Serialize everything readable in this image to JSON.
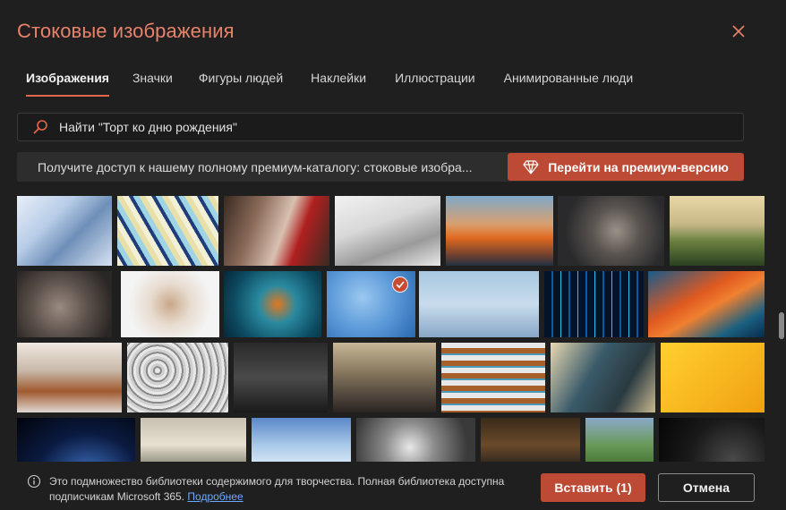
{
  "dialog": {
    "title": "Стоковые изображения",
    "accent_color": "#e0674a",
    "button_color": "#bc4a35"
  },
  "tabs": [
    {
      "label": "Изображения",
      "active": true
    },
    {
      "label": "Значки",
      "active": false
    },
    {
      "label": "Фигуры людей",
      "active": false
    },
    {
      "label": "Наклейки",
      "active": false
    },
    {
      "label": "Иллюстрации",
      "active": false
    },
    {
      "label": "Анимированные люди",
      "active": false
    }
  ],
  "search": {
    "value": "Найти \"Торт ко дню рождения\"",
    "icon": "search-icon"
  },
  "banner": {
    "text": "Получите доступ к нашему полному премиум-каталогу: стоковые изобра...",
    "button_label": "Перейти на премиум-версию",
    "button_icon": "diamond-icon"
  },
  "images": [
    {
      "label": "science-lab-glassware",
      "selected": false
    },
    {
      "label": "marbled-paint-swirl",
      "selected": false
    },
    {
      "label": "child-and-woman-masks",
      "selected": false
    },
    {
      "label": "typing-on-keyboard",
      "selected": false
    },
    {
      "label": "coastal-village-sunset",
      "selected": false
    },
    {
      "label": "monkey-portrait",
      "selected": false
    },
    {
      "label": "football-players-running",
      "selected": false
    },
    {
      "label": "hands-with-soap",
      "selected": false
    },
    {
      "label": "teddy-bear-with-mask",
      "selected": false
    },
    {
      "label": "sea-dragon-underwater",
      "selected": false
    },
    {
      "label": "confetti-balloons",
      "selected": true
    },
    {
      "label": "bald-eagle-flying",
      "selected": false
    },
    {
      "label": "digital-data-lights",
      "selected": false
    },
    {
      "label": "abstract-orange-waves",
      "selected": false
    },
    {
      "label": "woman-reading-library",
      "selected": false
    },
    {
      "label": "snowy-forest-aerial",
      "selected": false
    },
    {
      "label": "office-workspace",
      "selected": false
    },
    {
      "label": "team-meeting-room",
      "selected": false
    },
    {
      "label": "child-on-stairs",
      "selected": false
    },
    {
      "label": "man-with-tablet",
      "selected": false
    },
    {
      "label": "yellow-abstract",
      "selected": false
    },
    {
      "label": "earth-from-space",
      "selected": false
    },
    {
      "label": "white-tiger",
      "selected": false
    },
    {
      "label": "clouds-sky",
      "selected": false
    },
    {
      "label": "camera-lens-closeup",
      "selected": false
    },
    {
      "label": "judge-gavel",
      "selected": false
    },
    {
      "label": "green-hills",
      "selected": false
    },
    {
      "label": "speedometer",
      "selected": false
    }
  ],
  "footer": {
    "info_text": "Это подмножество библиотеки содержимого для творчества. Полная библиотека доступна подписчикам Microsoft 365.",
    "link_label": "Подробнее",
    "insert_label": "Вставить (1)",
    "cancel_label": "Отмена"
  }
}
